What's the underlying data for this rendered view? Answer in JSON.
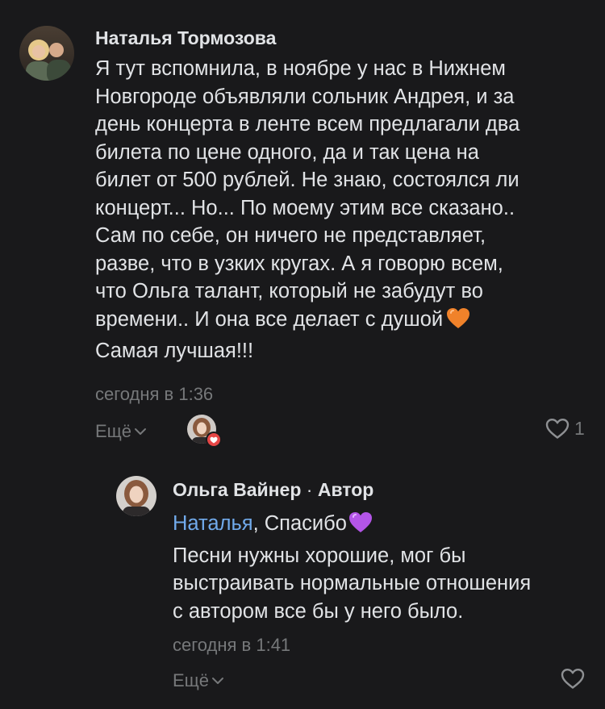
{
  "comment": {
    "author": "Наталья Тормозова",
    "lines": [
      "Я тут вспомнила, в ноябре у нас в Нижнем",
      "Новгороде объявляли сольник Андрея, и за",
      "день концерта в ленте всем предлагали два",
      "билета по цене одного, да и так цена на",
      "билет от 500 рублей. Не знаю, состоялся ли",
      "концерт... Но... По моему этим все сказано..",
      "Сам по себе, он ничего не представляет,",
      "разве, что в узких кругах. А я говорю всем,",
      "что Ольга талант, который не забудут во",
      "времени.. И она все делает с душой",
      "Самая лучшая!!!"
    ],
    "emoji_icon": "orange-heart-emoji",
    "time": "сегодня в 1:36",
    "more_label": "Ещё",
    "like_count": "1"
  },
  "reply": {
    "author": "Ольга Вайнер",
    "separator": " · ",
    "author_tag": "Автор",
    "mention": "Наталья",
    "first_line_rest": ", Спасибо",
    "emoji_icon": "purple-heart-emoji",
    "lines": [
      "Песни нужны хорошие, мог бы",
      "выстраивать нормальные отношения",
      "с автором все бы у него было."
    ],
    "time": "сегодня в 1:41",
    "more_label": "Ещё"
  },
  "colors": {
    "background": "#19191b",
    "text": "#e1e3e6",
    "secondary": "#76787a",
    "link": "#71aaeb",
    "like_badge": "#e64646"
  }
}
